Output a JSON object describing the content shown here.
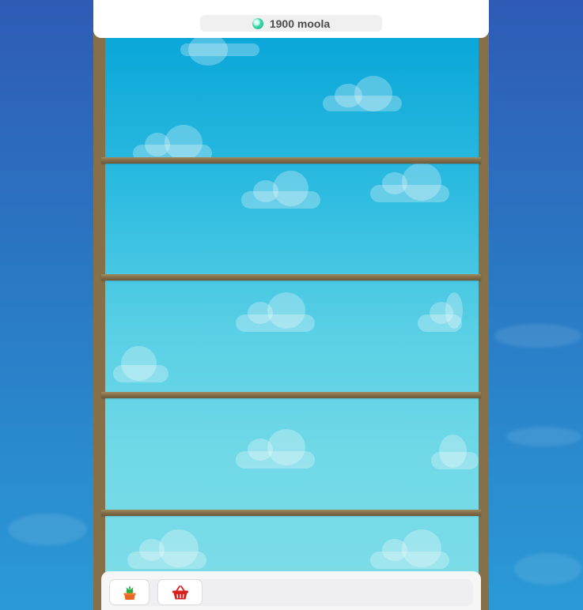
{
  "header": {
    "moola_icon": "moola-gem-icon",
    "moola_text": "1900 moola"
  },
  "shelves": {
    "count": 4,
    "rows": 5
  },
  "toolbar": {
    "buttons": [
      {
        "name": "plants-button",
        "icon": "potted-plant-icon"
      },
      {
        "name": "shop-button",
        "icon": "shopping-basket-icon"
      }
    ]
  },
  "colors": {
    "frame": "#85704a",
    "sky_top": "#0aa7d9",
    "sky_bottom": "#7fdde9",
    "pot": "#e8661f",
    "plant": "#2fa84a",
    "basket": "#d8201f",
    "gem": "#3ad7a6"
  }
}
